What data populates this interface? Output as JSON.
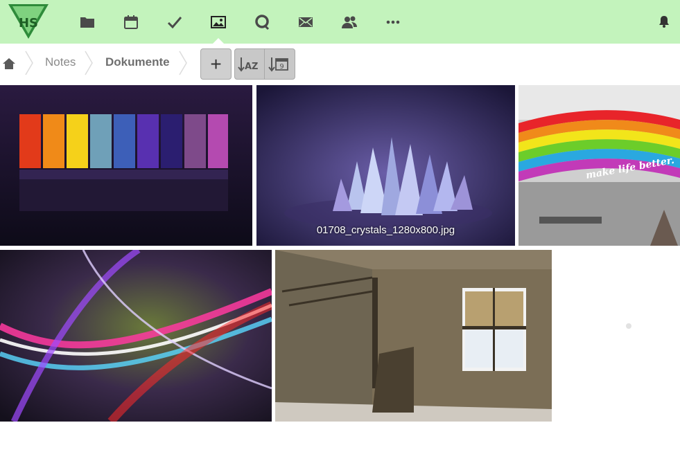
{
  "app": {
    "logo_text": "HS",
    "colors": {
      "header_bg": "#c3f3bc",
      "icon": "#4a4a4a",
      "logo_green": "#2e8b3a",
      "button_bg": "#c8c8c8"
    }
  },
  "nav": {
    "items": [
      {
        "icon": "folder-icon",
        "label": "Files"
      },
      {
        "icon": "calendar-icon",
        "label": "Calendar"
      },
      {
        "icon": "checkmark-icon",
        "label": "Tasks"
      },
      {
        "icon": "image-icon",
        "label": "Gallery",
        "active": true
      },
      {
        "icon": "talk-icon",
        "label": "Talk"
      },
      {
        "icon": "mail-icon",
        "label": "Mail"
      },
      {
        "icon": "contacts-icon",
        "label": "Contacts"
      },
      {
        "icon": "more-icon",
        "label": "More"
      }
    ],
    "notifications_icon": "bell-icon"
  },
  "breadcrumb": {
    "home_icon": "home-icon",
    "items": [
      "Notes",
      "Dokumente"
    ]
  },
  "toolbar": {
    "add_label": "+",
    "sort_name_icon": "sort-alpha-icon",
    "sort_name_text": "AZ",
    "sort_date_icon": "sort-date-icon",
    "sort_date_text": "9"
  },
  "gallery": {
    "images": [
      {
        "name": "rainbow-panels",
        "caption": ""
      },
      {
        "name": "crystals",
        "caption": "01708_crystals_1280x800.jpg"
      },
      {
        "name": "rainbow-newspaper",
        "caption": "",
        "overlay_text": "make life better."
      },
      {
        "name": "abstract-light-waves",
        "caption": ""
      },
      {
        "name": "abandoned-room",
        "caption": ""
      }
    ]
  }
}
